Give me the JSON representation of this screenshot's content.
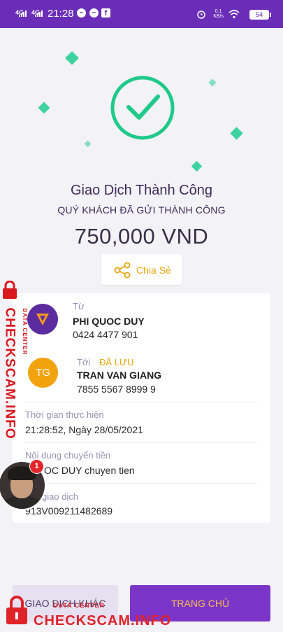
{
  "status_bar": {
    "time": "21:28",
    "net1": "4G",
    "net2": "4G",
    "speed": "0.1\nKB/s",
    "battery": "54"
  },
  "result": {
    "title": "Giao Dịch Thành Công",
    "subtitle": "QUÝ KHÁCH ĐÃ GỬI THÀNH CÔNG",
    "amount": "750,000 VND",
    "share_label": "Chia Sẻ"
  },
  "details": {
    "from_label": "Từ",
    "from_name": "PHI QUOC DUY",
    "from_account": "0424 4477 901",
    "to_label": "Tới",
    "saved_label": "ĐÃ LƯU",
    "to_initials": "TG",
    "to_name": "TRAN VAN GIANG",
    "to_account": "7855 5567 8999 9",
    "time_label": "Thời gian thực hiện",
    "time_value": "21:28:52, Ngày 28/05/2021",
    "content_label": "Nội dung chuyển tiền",
    "content_value": "OC DUY chuyen tien",
    "code_label": "giao dịch",
    "code_value": "913V009211482689"
  },
  "buttons": {
    "other": "GIAO DỊCH KHÁC",
    "home": "TRANG CHỦ"
  },
  "watermark": {
    "vertical_big": "CHECKSCAM.INFO",
    "vertical_small": "DATA CENTER",
    "bottom_big": "CHECKSCAM.INFO",
    "bottom_small": "DATA CENTER"
  },
  "bubble_badge": "1",
  "colors": {
    "header": "#6a2db8",
    "accent": "#e5a60b",
    "success": "#1fc98a",
    "primary_button": "#7b35c9"
  }
}
